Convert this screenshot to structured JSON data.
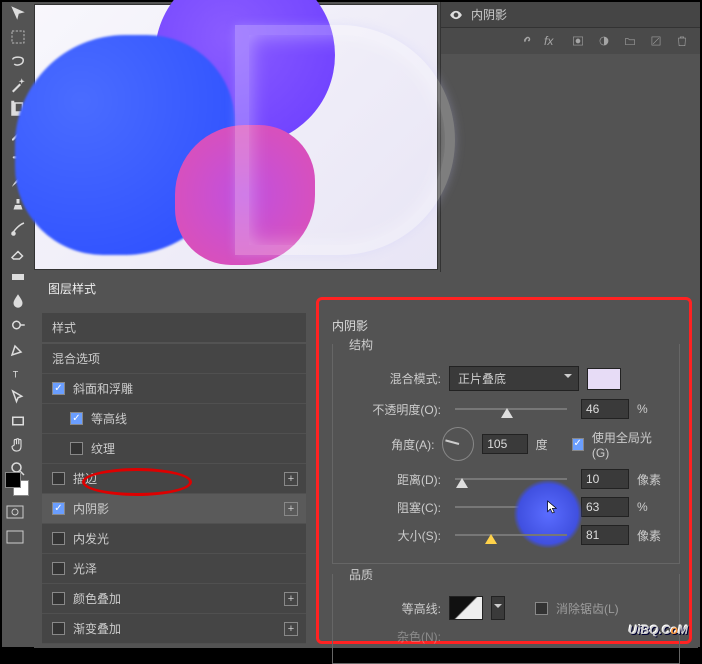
{
  "layers_panel": {
    "effect_name": "内阴影",
    "footer_icons": [
      "link-icon",
      "fx-icon",
      "mask-icon",
      "adjustment-icon",
      "group-icon",
      "new-layer-icon",
      "trash-icon"
    ]
  },
  "dialog": {
    "title": "图层样式",
    "left": {
      "styles_header": "样式",
      "blend_options": "混合选项",
      "items": [
        {
          "label": "斜面和浮雕",
          "checked": true,
          "plus": false
        },
        {
          "label": "等高线",
          "checked": true,
          "plus": false,
          "indent": true
        },
        {
          "label": "纹理",
          "checked": false,
          "plus": false,
          "indent": true
        },
        {
          "label": "描边",
          "checked": false,
          "plus": true
        },
        {
          "label": "内阴影",
          "checked": true,
          "plus": true,
          "selected": true
        },
        {
          "label": "内发光",
          "checked": false,
          "plus": false
        },
        {
          "label": "光泽",
          "checked": false,
          "plus": false
        },
        {
          "label": "颜色叠加",
          "checked": false,
          "plus": true
        },
        {
          "label": "渐变叠加",
          "checked": false,
          "plus": true
        }
      ]
    },
    "right": {
      "section_title": "内阴影",
      "structure_label": "结构",
      "blend_mode_label": "混合模式:",
      "blend_mode_value": "正片叠底",
      "swatch_color": "#e7dcf6",
      "opacity_label": "不透明度(O):",
      "opacity_value": "46",
      "opacity_unit": "%",
      "angle_label": "角度(A):",
      "angle_value": "105",
      "angle_unit": "度",
      "global_light_label": "使用全局光 (G)",
      "global_light_checked": true,
      "distance_label": "距离(D):",
      "distance_value": "10",
      "distance_unit": "像素",
      "choke_label": "阻塞(C):",
      "choke_value": "63",
      "choke_unit": "%",
      "size_label": "大小(S):",
      "size_value": "81",
      "size_unit": "像素",
      "quality_label": "品质",
      "contour_label": "等高线:",
      "antialias_label": "消除锯齿(L)",
      "noise_label": "杂色(N):"
    }
  },
  "watermark": {
    "text_pre": "UiBQ.C",
    "text_o": "o",
    "text_post": "M"
  }
}
